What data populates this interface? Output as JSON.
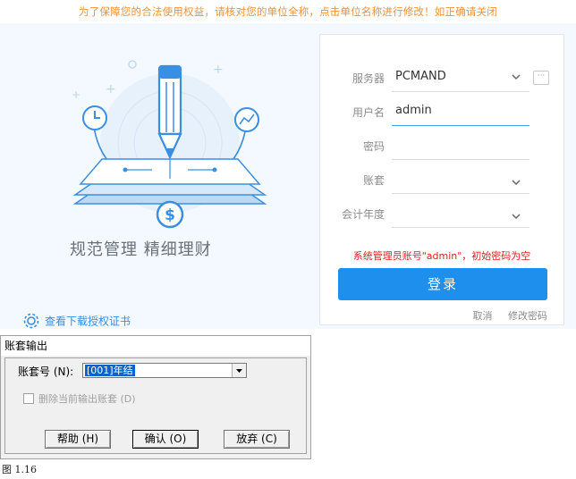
{
  "login": {
    "notice": "为了保障您的合法使用权益，请核对您的单位全称，点击单位名称进行修改！如正确请关闭",
    "slogan": "规范管理  精细理财",
    "cert_link": "查看下载授权证书",
    "fields": {
      "server_label": "服务器",
      "server_value": "PCMAND",
      "user_label": "用户名",
      "user_value": "admin",
      "password_label": "密码",
      "password_value": "",
      "account_label": "账套",
      "account_value": "",
      "year_label": "会计年度",
      "year_value": ""
    },
    "more_icon": "ellipsis-icon",
    "hint": "系统管理员账号\"admin\"，初始密码为空",
    "login_button": "登录",
    "cancel_link": "取消",
    "change_password_link": "修改密码",
    "colors": {
      "accent": "#1f8fee",
      "hint": "#e02020",
      "notice": "#f0913a"
    }
  },
  "dialog": {
    "title": "账套输出",
    "account_label": "账套号 (N):",
    "account_selected": "[001]年结",
    "delete_checkbox_label": "删除当前输出账套 (D)",
    "delete_checked": false,
    "buttons": {
      "help": "帮助 (H)",
      "ok": "确认 (O)",
      "cancel": "放弃 (C)"
    }
  },
  "caption": "图 1.16"
}
